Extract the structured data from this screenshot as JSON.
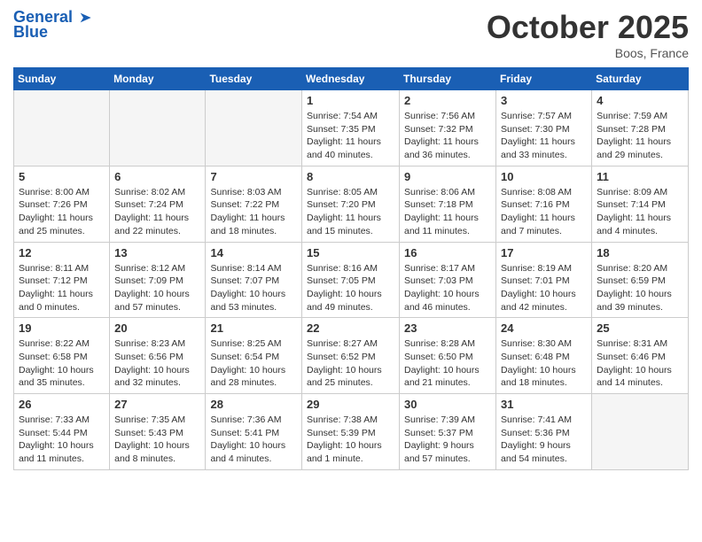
{
  "header": {
    "logo_line1": "General",
    "logo_line2": "Blue",
    "month_title": "October 2025",
    "location": "Boos, France"
  },
  "weekdays": [
    "Sunday",
    "Monday",
    "Tuesday",
    "Wednesday",
    "Thursday",
    "Friday",
    "Saturday"
  ],
  "weeks": [
    [
      {
        "day": "",
        "info": ""
      },
      {
        "day": "",
        "info": ""
      },
      {
        "day": "",
        "info": ""
      },
      {
        "day": "1",
        "info": "Sunrise: 7:54 AM\nSunset: 7:35 PM\nDaylight: 11 hours\nand 40 minutes."
      },
      {
        "day": "2",
        "info": "Sunrise: 7:56 AM\nSunset: 7:32 PM\nDaylight: 11 hours\nand 36 minutes."
      },
      {
        "day": "3",
        "info": "Sunrise: 7:57 AM\nSunset: 7:30 PM\nDaylight: 11 hours\nand 33 minutes."
      },
      {
        "day": "4",
        "info": "Sunrise: 7:59 AM\nSunset: 7:28 PM\nDaylight: 11 hours\nand 29 minutes."
      }
    ],
    [
      {
        "day": "5",
        "info": "Sunrise: 8:00 AM\nSunset: 7:26 PM\nDaylight: 11 hours\nand 25 minutes."
      },
      {
        "day": "6",
        "info": "Sunrise: 8:02 AM\nSunset: 7:24 PM\nDaylight: 11 hours\nand 22 minutes."
      },
      {
        "day": "7",
        "info": "Sunrise: 8:03 AM\nSunset: 7:22 PM\nDaylight: 11 hours\nand 18 minutes."
      },
      {
        "day": "8",
        "info": "Sunrise: 8:05 AM\nSunset: 7:20 PM\nDaylight: 11 hours\nand 15 minutes."
      },
      {
        "day": "9",
        "info": "Sunrise: 8:06 AM\nSunset: 7:18 PM\nDaylight: 11 hours\nand 11 minutes."
      },
      {
        "day": "10",
        "info": "Sunrise: 8:08 AM\nSunset: 7:16 PM\nDaylight: 11 hours\nand 7 minutes."
      },
      {
        "day": "11",
        "info": "Sunrise: 8:09 AM\nSunset: 7:14 PM\nDaylight: 11 hours\nand 4 minutes."
      }
    ],
    [
      {
        "day": "12",
        "info": "Sunrise: 8:11 AM\nSunset: 7:12 PM\nDaylight: 11 hours\nand 0 minutes."
      },
      {
        "day": "13",
        "info": "Sunrise: 8:12 AM\nSunset: 7:09 PM\nDaylight: 10 hours\nand 57 minutes."
      },
      {
        "day": "14",
        "info": "Sunrise: 8:14 AM\nSunset: 7:07 PM\nDaylight: 10 hours\nand 53 minutes."
      },
      {
        "day": "15",
        "info": "Sunrise: 8:16 AM\nSunset: 7:05 PM\nDaylight: 10 hours\nand 49 minutes."
      },
      {
        "day": "16",
        "info": "Sunrise: 8:17 AM\nSunset: 7:03 PM\nDaylight: 10 hours\nand 46 minutes."
      },
      {
        "day": "17",
        "info": "Sunrise: 8:19 AM\nSunset: 7:01 PM\nDaylight: 10 hours\nand 42 minutes."
      },
      {
        "day": "18",
        "info": "Sunrise: 8:20 AM\nSunset: 6:59 PM\nDaylight: 10 hours\nand 39 minutes."
      }
    ],
    [
      {
        "day": "19",
        "info": "Sunrise: 8:22 AM\nSunset: 6:58 PM\nDaylight: 10 hours\nand 35 minutes."
      },
      {
        "day": "20",
        "info": "Sunrise: 8:23 AM\nSunset: 6:56 PM\nDaylight: 10 hours\nand 32 minutes."
      },
      {
        "day": "21",
        "info": "Sunrise: 8:25 AM\nSunset: 6:54 PM\nDaylight: 10 hours\nand 28 minutes."
      },
      {
        "day": "22",
        "info": "Sunrise: 8:27 AM\nSunset: 6:52 PM\nDaylight: 10 hours\nand 25 minutes."
      },
      {
        "day": "23",
        "info": "Sunrise: 8:28 AM\nSunset: 6:50 PM\nDaylight: 10 hours\nand 21 minutes."
      },
      {
        "day": "24",
        "info": "Sunrise: 8:30 AM\nSunset: 6:48 PM\nDaylight: 10 hours\nand 18 minutes."
      },
      {
        "day": "25",
        "info": "Sunrise: 8:31 AM\nSunset: 6:46 PM\nDaylight: 10 hours\nand 14 minutes."
      }
    ],
    [
      {
        "day": "26",
        "info": "Sunrise: 7:33 AM\nSunset: 5:44 PM\nDaylight: 10 hours\nand 11 minutes."
      },
      {
        "day": "27",
        "info": "Sunrise: 7:35 AM\nSunset: 5:43 PM\nDaylight: 10 hours\nand 8 minutes."
      },
      {
        "day": "28",
        "info": "Sunrise: 7:36 AM\nSunset: 5:41 PM\nDaylight: 10 hours\nand 4 minutes."
      },
      {
        "day": "29",
        "info": "Sunrise: 7:38 AM\nSunset: 5:39 PM\nDaylight: 10 hours\nand 1 minute."
      },
      {
        "day": "30",
        "info": "Sunrise: 7:39 AM\nSunset: 5:37 PM\nDaylight: 9 hours\nand 57 minutes."
      },
      {
        "day": "31",
        "info": "Sunrise: 7:41 AM\nSunset: 5:36 PM\nDaylight: 9 hours\nand 54 minutes."
      },
      {
        "day": "",
        "info": ""
      }
    ]
  ]
}
